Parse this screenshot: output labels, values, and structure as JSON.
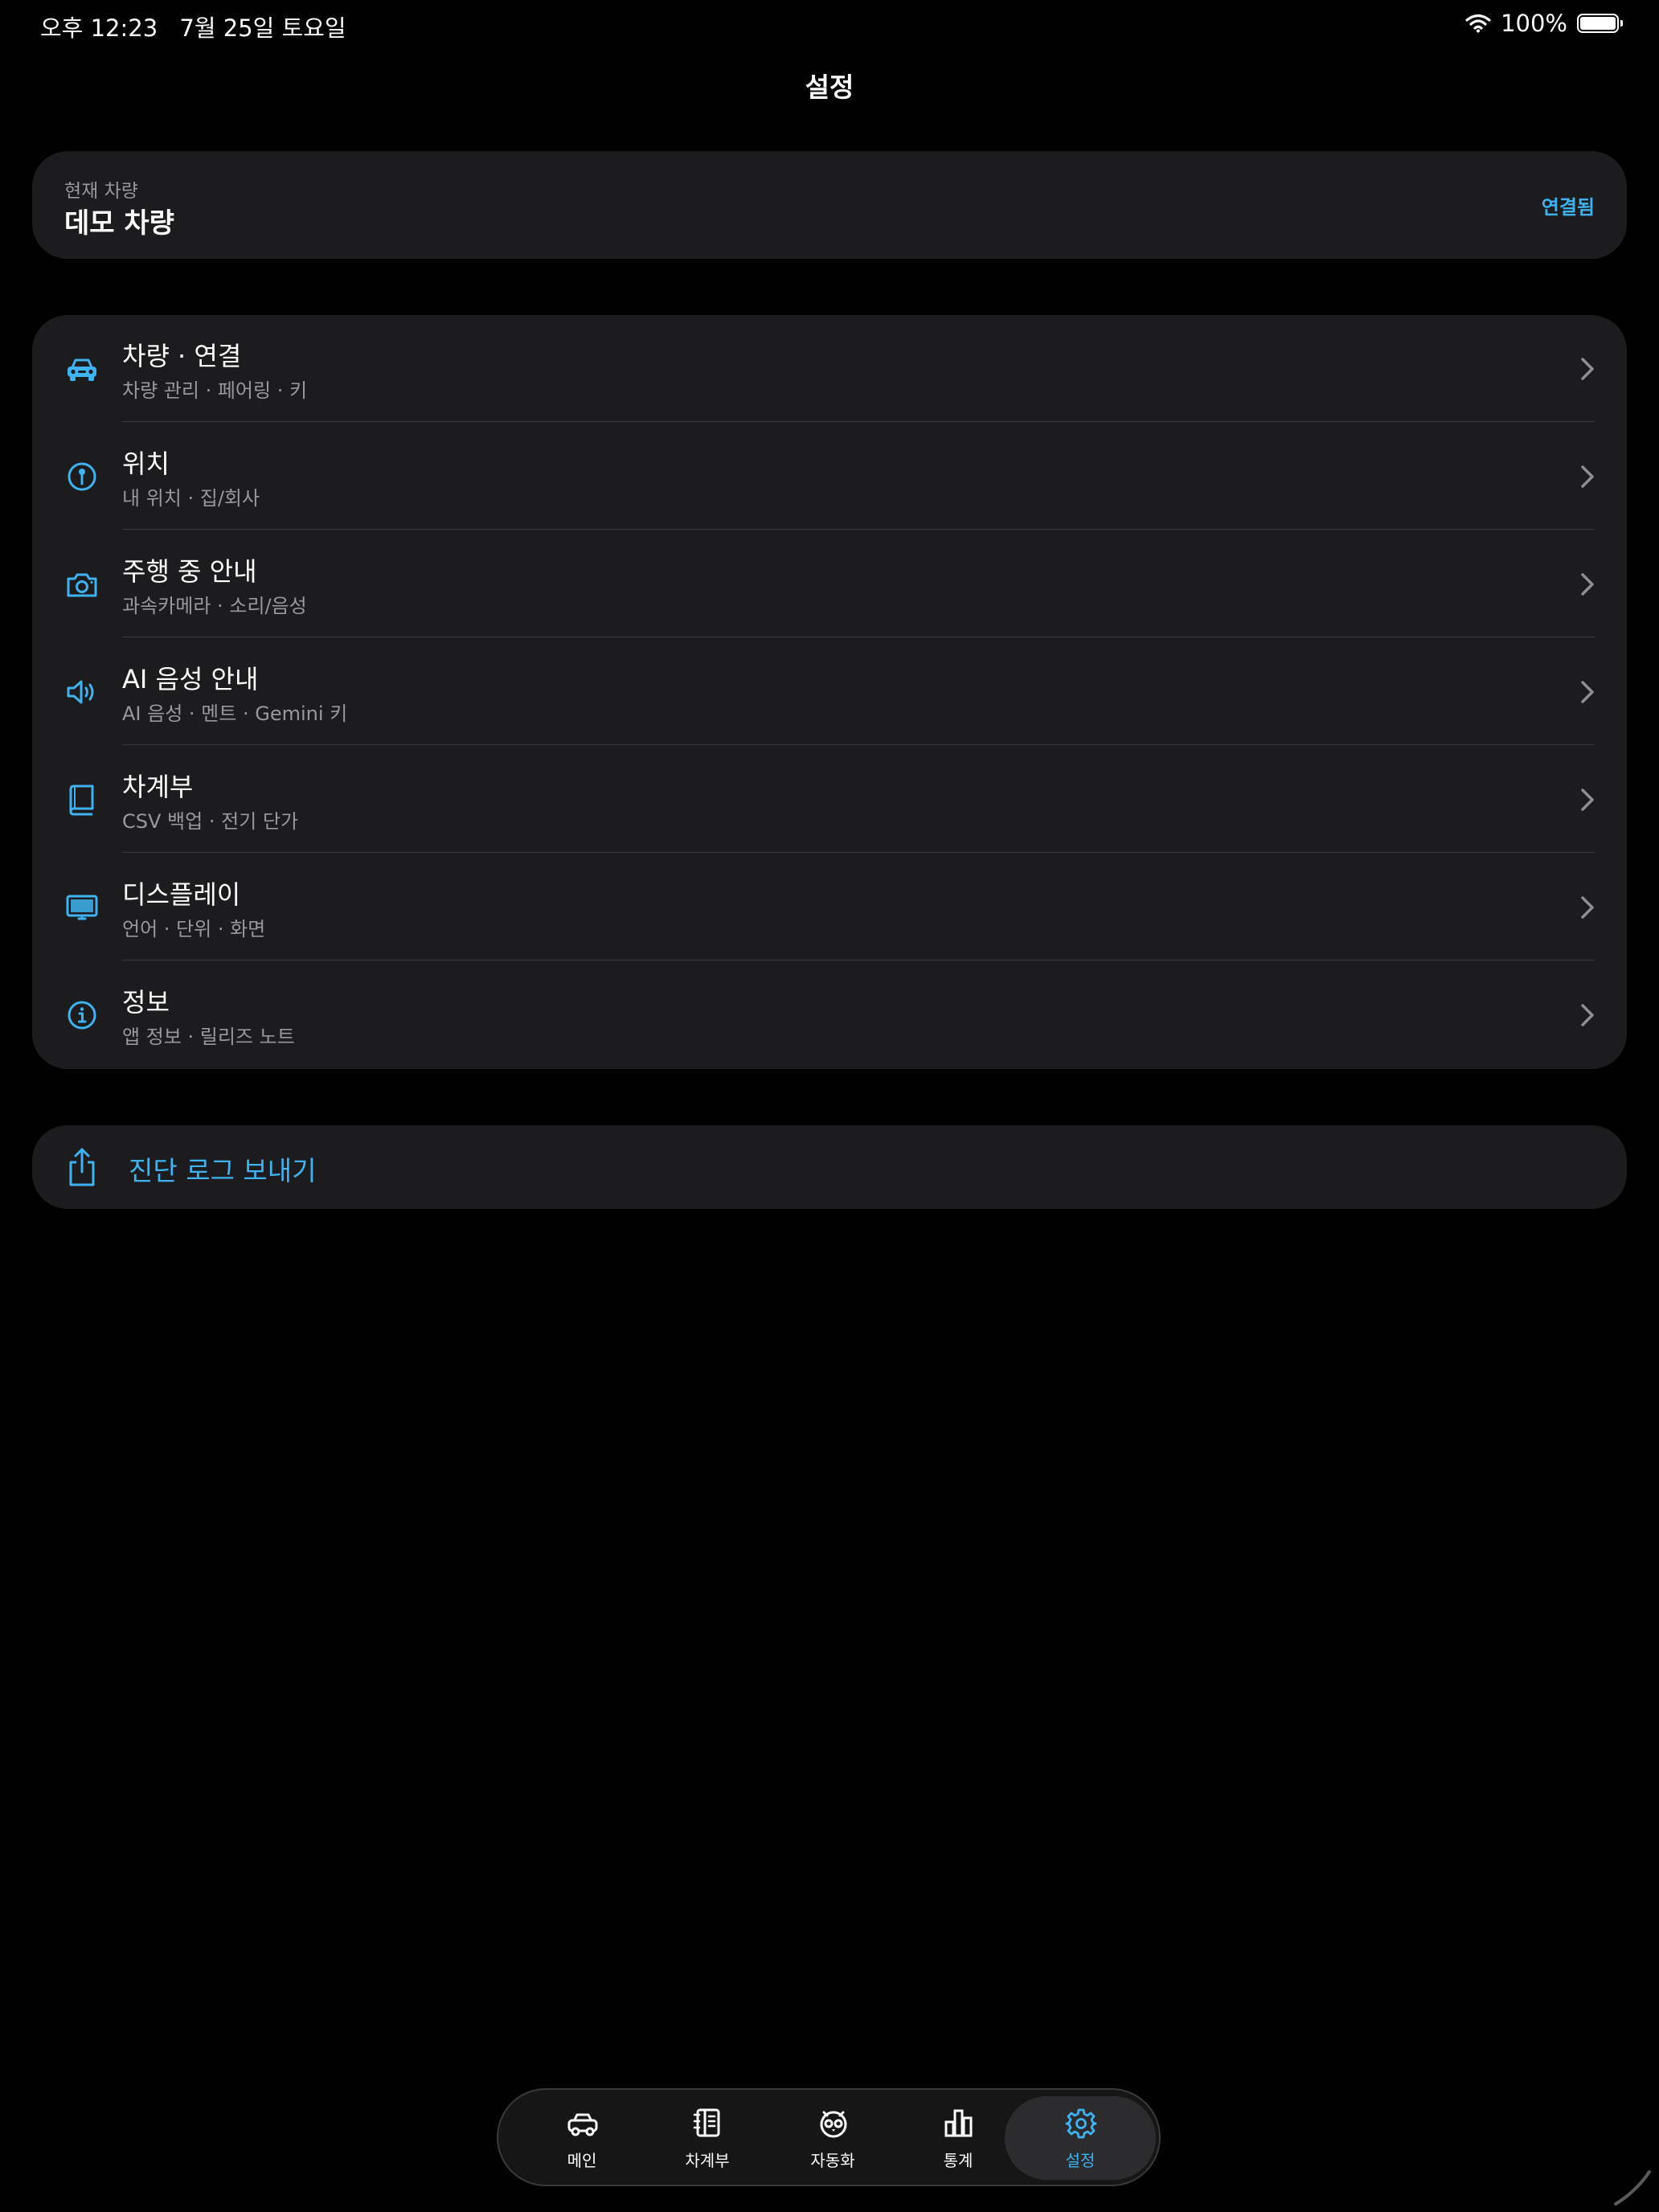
{
  "status_bar": {
    "time": "오후 12:23",
    "date": "7월 25일 토요일",
    "battery_label": "100%",
    "battery_level": 1.0
  },
  "header": {
    "title": "설정"
  },
  "accent_color": "#3fb2f0",
  "vehicle": {
    "label": "현재 차량",
    "name": "데모 차량",
    "status": "연결됨"
  },
  "menu": [
    {
      "icon": "car-icon",
      "title": "차량 · 연결",
      "subtitle": "차량 관리 · 페어링 · 키"
    },
    {
      "icon": "location-pin-icon",
      "title": "위치",
      "subtitle": "내 위치 · 집/회사"
    },
    {
      "icon": "camera-icon",
      "title": "주행 중 안내",
      "subtitle": "과속카메라 · 소리/음성"
    },
    {
      "icon": "speaker-icon",
      "title": "AI 음성 안내",
      "subtitle": "AI 음성 · 멘트 · Gemini 키"
    },
    {
      "icon": "book-icon",
      "title": "차계부",
      "subtitle": "CSV 백업 · 전기 단가"
    },
    {
      "icon": "display-icon",
      "title": "디스플레이",
      "subtitle": "언어 · 단위 · 화면"
    },
    {
      "icon": "info-icon",
      "title": "정보",
      "subtitle": "앱 정보 · 릴리즈 노트"
    }
  ],
  "export": {
    "icon": "share-icon",
    "label": "진단 로그 보내기"
  },
  "tabs": [
    {
      "icon": "car-icon",
      "label": "메인",
      "active": false
    },
    {
      "icon": "notebook-icon",
      "label": "차계부",
      "active": false
    },
    {
      "icon": "owl-icon",
      "label": "자동화",
      "active": false
    },
    {
      "icon": "bar-chart-icon",
      "label": "통계",
      "active": false
    },
    {
      "icon": "gear-icon",
      "label": "설정",
      "active": true
    }
  ]
}
